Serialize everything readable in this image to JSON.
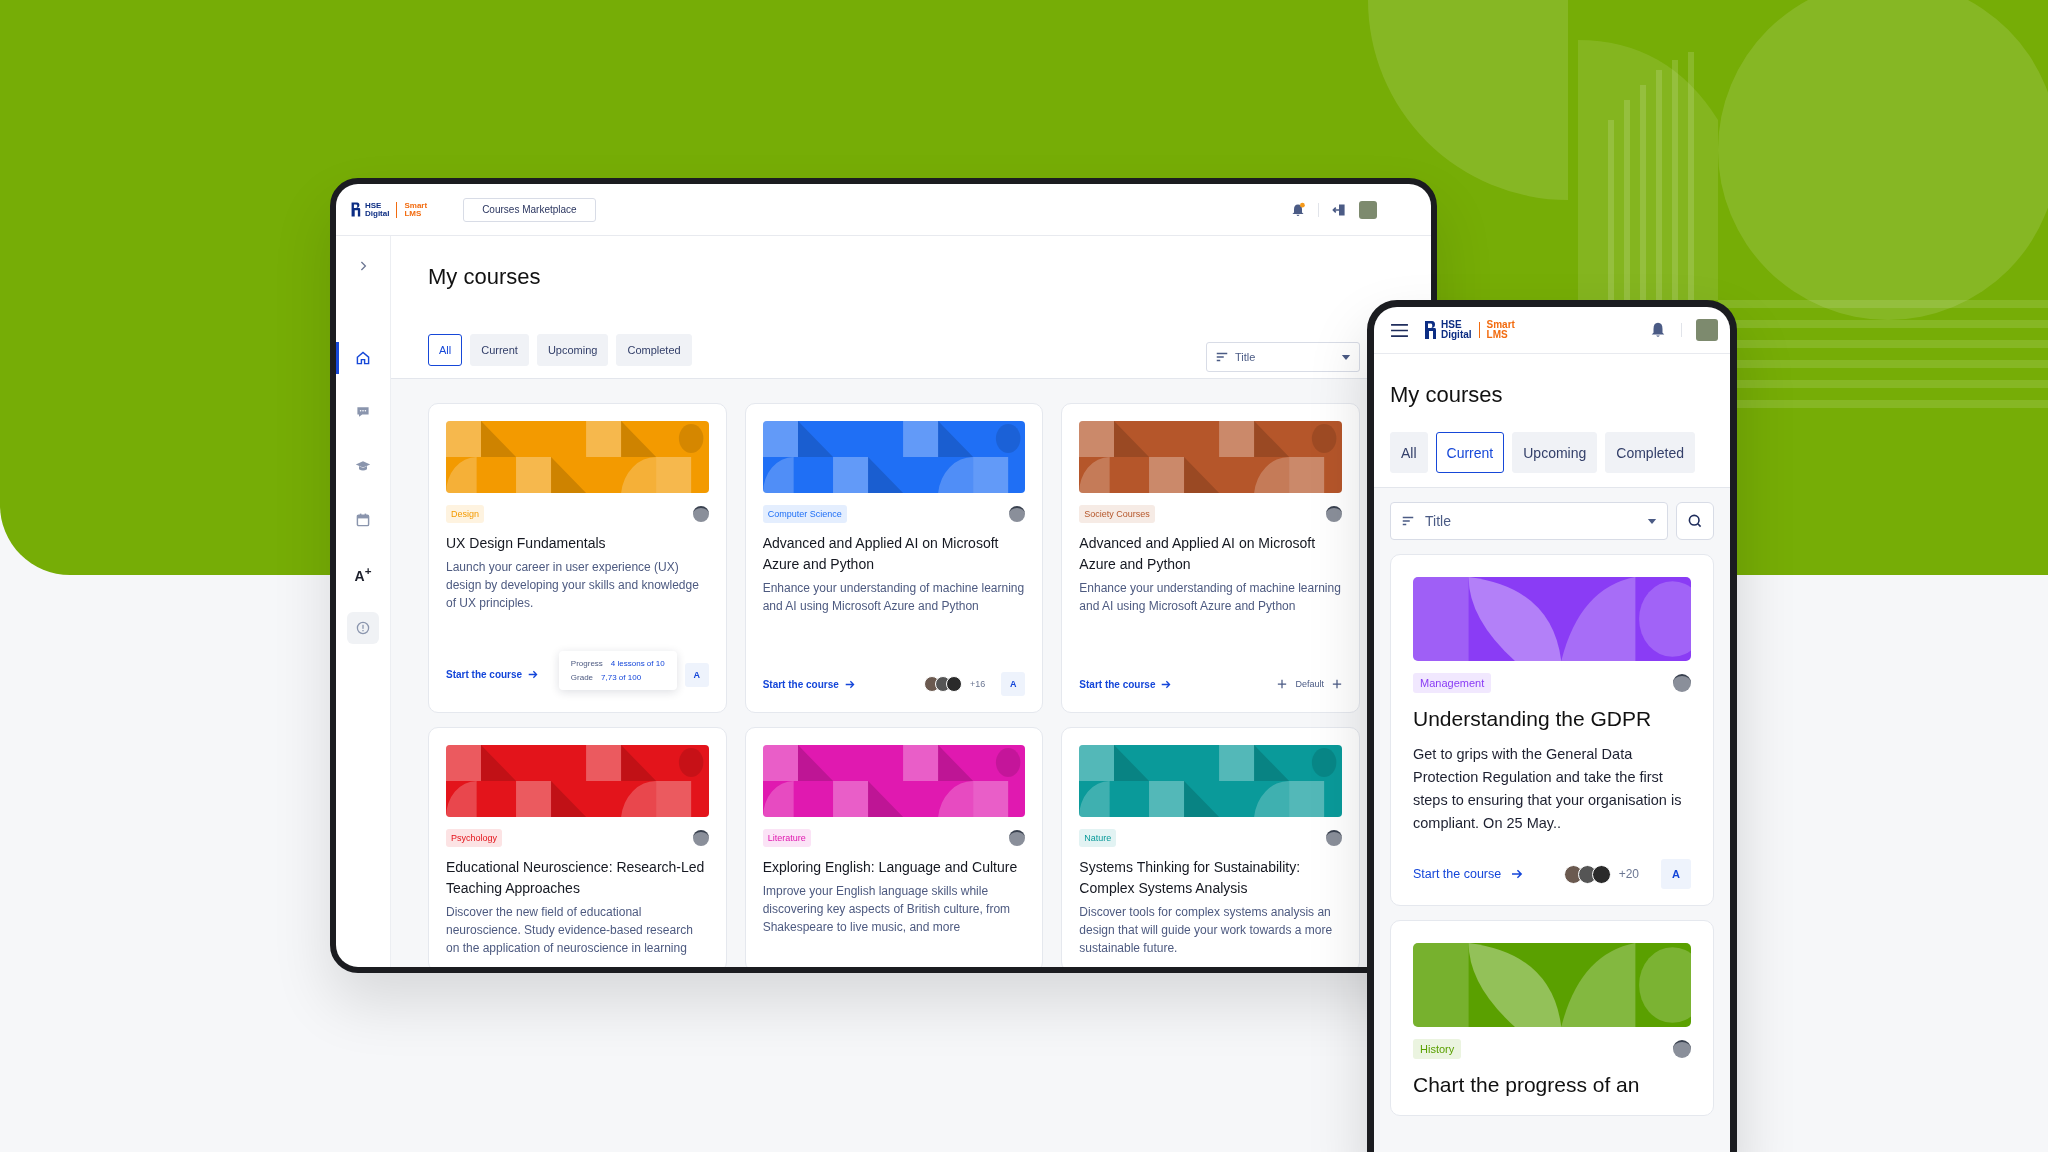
{
  "tablet": {
    "header": {
      "logo": "HSE Digital",
      "product": "Smart LMS",
      "marketplace_button": "Courses Marketplace",
      "has_notification": true
    },
    "sidebar": [
      {
        "kind": "expand"
      },
      {
        "kind": "home",
        "selected": true
      },
      {
        "kind": "chat",
        "selected": false
      },
      {
        "kind": "cap",
        "selected": false
      },
      {
        "kind": "calendar",
        "selected": false
      },
      {
        "kind": "grade",
        "label": "A$^{+}$",
        "selected": false
      },
      {
        "kind": "alert",
        "selected": false
      }
    ],
    "title": "My courses",
    "tabs": [
      {
        "label": "All",
        "selected": true
      },
      {
        "label": "Current",
        "selected": false
      },
      {
        "label": "Upcoming",
        "selected": false
      },
      {
        "label": "Completed",
        "selected": false
      }
    ],
    "sort": {
      "label": "Title"
    },
    "courses": [
      {
        "tag": "Design",
        "color": "#f39a00",
        "title": "UX Design Fundamentals",
        "description": "Launch your career in user experience (UX) design by developing your skills and knowledge of UX principles.",
        "footer": {
          "kind": "progress",
          "link": "Start the course",
          "progress_label": "Progress",
          "progress_value": "4 lessons of 10",
          "grade_label": "Grade",
          "grade_value": "7,73 of 100",
          "badge": "A"
        }
      },
      {
        "tag": "Computer Science",
        "color": "#1f6ff5",
        "title": "Advanced and Applied AI on Microsoft Azure and Python",
        "description": "Enhance your understanding of machine learning and AI using Microsoft Azure and Python",
        "footer": {
          "kind": "learners",
          "link": "Start the course",
          "count": "+16",
          "badge": "A"
        }
      },
      {
        "tag": "Society Courses",
        "color": "#b5562a",
        "title": "Advanced and Applied AI on Microsoft Azure and Python",
        "description": "Enhance your understanding of machine learning and AI using Microsoft Azure and Python",
        "footer": {
          "kind": "default",
          "link": "Start the course",
          "label": "Default"
        }
      },
      {
        "tag": "Psychology",
        "color": "#e3141b",
        "title": "Educational Neuroscience: Research-Led Teaching Approaches",
        "description": "Discover the new field of educational neuroscience. Study evidence-based research on the application of neuroscience in learning"
      },
      {
        "tag": "Literature",
        "color": "#e019b0",
        "title": "Exploring English: Language and Culture",
        "description": "Improve your English language skills while discovering key aspects of British culture, from Shakespeare to live music, and more"
      },
      {
        "tag": "Nature",
        "color": "#0a9a9a",
        "title": "Systems Thinking for Sustainability: Complex Systems Analysis",
        "description": "Discover tools for complex systems analysis an design that will guide your work towards a more sustainable future."
      }
    ]
  },
  "phone": {
    "header": {
      "logo": "HSE Digital",
      "product": "Smart LMS"
    },
    "title": "My courses",
    "tabs": [
      {
        "label": "All",
        "selected": false
      },
      {
        "label": "Current",
        "selected": true
      },
      {
        "label": "Upcoming",
        "selected": false
      },
      {
        "label": "Completed",
        "selected": false
      }
    ],
    "sort": {
      "label": "Title"
    },
    "courses": [
      {
        "tag": "Management",
        "color": "#8a3cf5",
        "title": "Understanding the GDPR",
        "description": "Get to grips with the General Data Protection Regulation and take the first steps to ensuring that your organisation is compliant. On 25 May..",
        "footer": {
          "kind": "learners",
          "link": "Start the course",
          "count": "+20",
          "badge": "A"
        }
      },
      {
        "tag": "History",
        "color": "#5aa000",
        "title": "Chart the progress of an"
      }
    ]
  }
}
